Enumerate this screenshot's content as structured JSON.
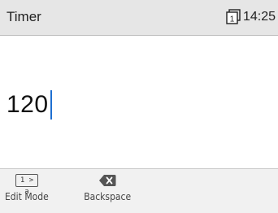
{
  "header": {
    "title": "Timer",
    "sim_icon": "sim-card-1-icon",
    "sim_number": "1",
    "time": "14:25"
  },
  "main": {
    "timer_input_value": "120"
  },
  "softkeys": {
    "edit_mode": {
      "icon": "input-mode-icon",
      "icon_text": "1 > a",
      "label": "Edit Mode"
    },
    "backspace": {
      "icon": "backspace-icon",
      "label": "Backspace"
    }
  },
  "colors": {
    "caret": "#1e6fd1",
    "titlebar_bg": "#e6e6e6",
    "softbar_bg": "#f1f1f1"
  }
}
